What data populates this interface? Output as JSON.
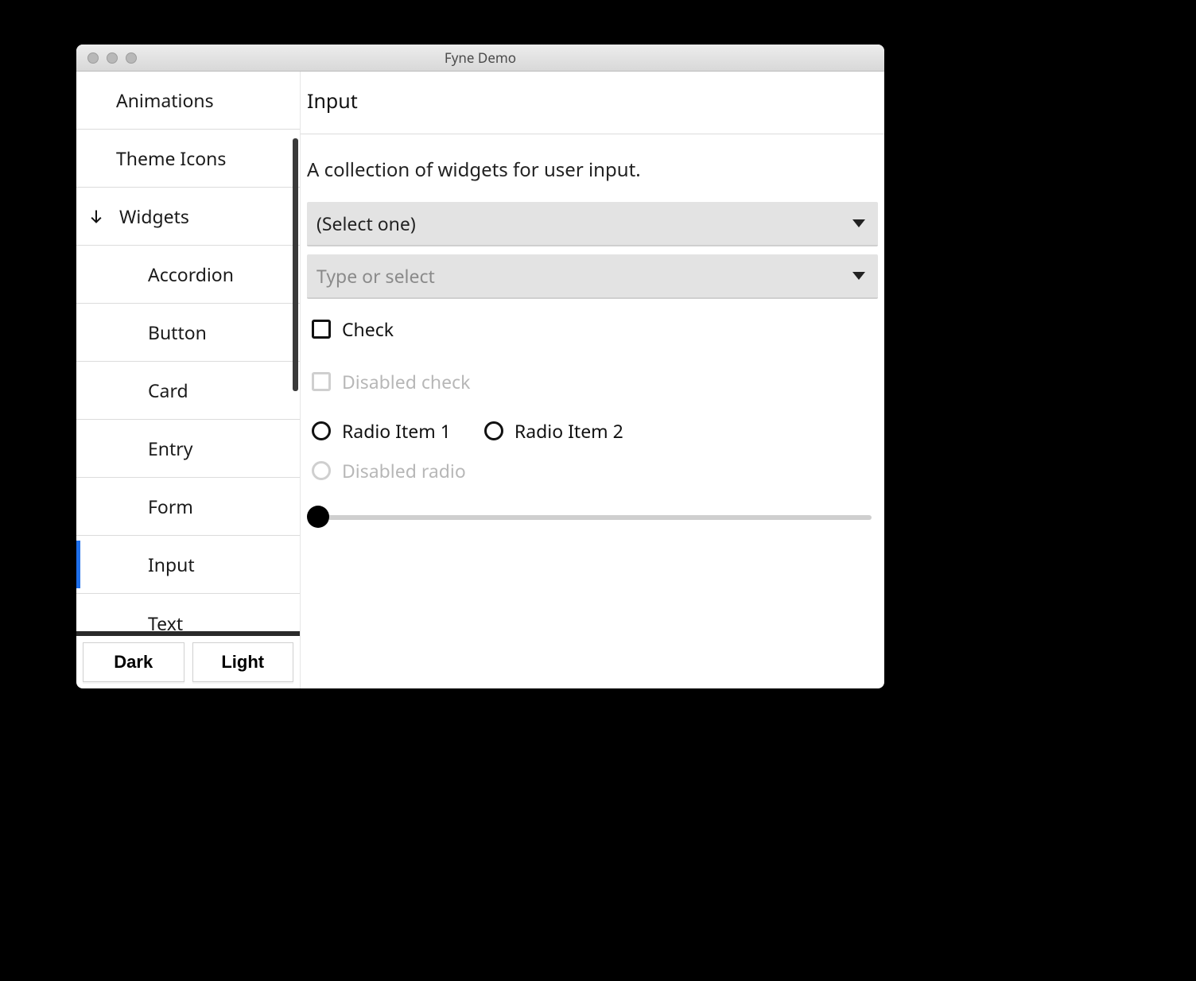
{
  "window": {
    "title": "Fyne Demo"
  },
  "sidebar": {
    "items": [
      {
        "label": "Animations"
      },
      {
        "label": "Theme Icons"
      }
    ],
    "group": {
      "label": "Widgets"
    },
    "subitems": [
      {
        "label": "Accordion"
      },
      {
        "label": "Button"
      },
      {
        "label": "Card"
      },
      {
        "label": "Entry"
      },
      {
        "label": "Form"
      },
      {
        "label": "Input",
        "selected": true
      },
      {
        "label": "Text"
      }
    ],
    "theme": {
      "dark": "Dark",
      "light": "Light"
    }
  },
  "main": {
    "title": "Input",
    "description": "A collection of widgets for user input.",
    "select1": {
      "label": "(Select one)"
    },
    "select2": {
      "placeholder": "Type or select"
    },
    "check": {
      "label": "Check"
    },
    "check_disabled": {
      "label": "Disabled check"
    },
    "radio": {
      "item1": "Radio Item 1",
      "item2": "Radio Item 2"
    },
    "radio_disabled": {
      "label": "Disabled radio"
    },
    "slider": {
      "value": 0,
      "min": 0,
      "max": 100
    }
  }
}
